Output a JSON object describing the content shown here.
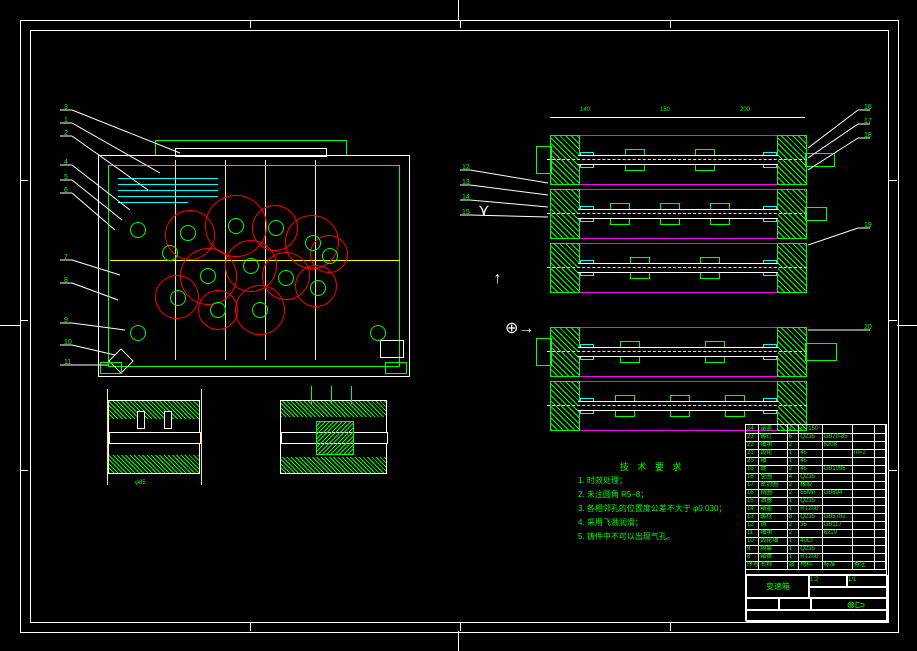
{
  "notes": {
    "title": "技 术 要 求",
    "items": [
      "1. 时效处理；",
      "2. 未注圆角 R5–8；",
      "3. 各相邻孔的位置度公差不大于 φ0.030；",
      "4. 采用飞溅润滑；",
      "5. 铸件中不可以出现气孔。"
    ]
  },
  "leader_labels": {
    "l1": "1",
    "l2": "2",
    "l3": "3",
    "l4": "4",
    "l5": "5",
    "l6": "6",
    "l7": "7",
    "l8": "8",
    "l9": "9",
    "l10": "10",
    "l11": "11",
    "l12": "12",
    "l13": "13",
    "l14": "14"
  },
  "right_labels": {
    "r1": "15",
    "r2": "16",
    "r3": "17",
    "r4": "18",
    "r5": "19",
    "r6": "20"
  },
  "dims": {
    "d1": "140",
    "d2": "180",
    "d3": "200",
    "d4": "φ85"
  },
  "title_block": {
    "rows": [
      [
        "24",
        "端盖",
        "1",
        "HT150",
        "",
        "",
        ""
      ],
      [
        "23",
        "螺钉",
        "6",
        "Q235",
        "GB70-85",
        "",
        ""
      ],
      [
        "22",
        "轴承",
        "2",
        "",
        "6208",
        "",
        ""
      ],
      [
        "21",
        "齿轮",
        "1",
        "45",
        "",
        "m=2",
        ""
      ],
      [
        "20",
        "轴",
        "1",
        "45",
        "",
        "",
        ""
      ],
      [
        "19",
        "键",
        "2",
        "45",
        "GB1096",
        "",
        ""
      ],
      [
        "18",
        "垫圈",
        "4",
        "Q235",
        "",
        "",
        ""
      ],
      [
        "17",
        "密封圈",
        "2",
        "橡胶",
        "",
        "",
        ""
      ],
      [
        "16",
        "挡圈",
        "2",
        "65Mn",
        "GB894",
        "",
        ""
      ],
      [
        "15",
        "油塞",
        "1",
        "Q235",
        "",
        "",
        ""
      ],
      [
        "14",
        "箱盖",
        "1",
        "HT200",
        "",
        "",
        ""
      ],
      [
        "13",
        "螺栓",
        "8",
        "Q235",
        "GB5782",
        "",
        ""
      ],
      [
        "12",
        "销",
        "2",
        "35",
        "GB117",
        "",
        ""
      ],
      [
        "11",
        "轴承",
        "2",
        "",
        "6210",
        "",
        ""
      ],
      [
        "10",
        "齿轮轴",
        "1",
        "40Cr",
        "",
        "",
        ""
      ],
      [
        "9",
        "隔套",
        "1",
        "Q235",
        "",
        "",
        ""
      ],
      [
        "8",
        "箱体",
        "1",
        "HT200",
        "",
        "",
        ""
      ],
      [
        "序号",
        "名称",
        "数",
        "材料",
        "标准",
        "备注",
        ""
      ]
    ],
    "bottom": {
      "proj": "变速箱",
      "scale": "1:2",
      "drawn": "",
      "check": "",
      "date": "",
      "dwgno": "",
      "sheet": "1/1",
      "dept": ""
    }
  }
}
